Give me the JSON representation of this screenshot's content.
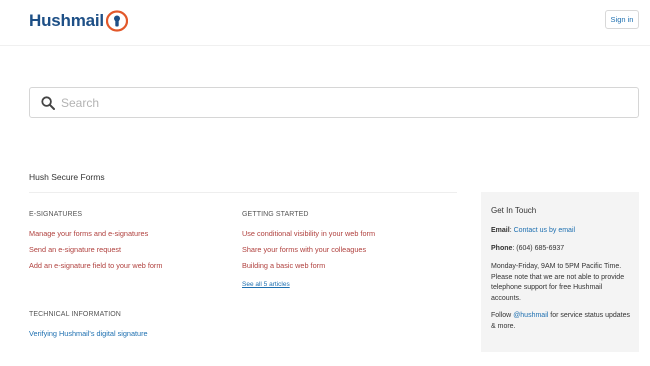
{
  "header": {
    "logo_text_a": "Hush",
    "logo_text_b": "mail",
    "signin_label": "Sign in"
  },
  "search": {
    "placeholder": "Search",
    "value": ""
  },
  "main": {
    "section_title": "Hush Secure Forms",
    "categories": [
      {
        "title": "E-SIGNATURES",
        "articles": [
          "Manage your forms and e-signatures",
          "Send an e-signature request",
          "Add an e-signature field to your web form"
        ]
      },
      {
        "title": "GETTING STARTED",
        "articles": [
          "Use conditional visibility in your web form",
          "Share your forms with your colleagues",
          "Building a basic web form"
        ],
        "see_all": "See all 5 articles"
      },
      {
        "title": "TECHNICAL INFORMATION",
        "articles": [
          "Verifying Hushmail's digital signature"
        ]
      }
    ]
  },
  "contact": {
    "title": "Get In Touch",
    "email_label": "Email",
    "email_link": "Contact us by email",
    "phone_label": "Phone",
    "phone_value": "(604) 685-6937",
    "hours_text": "Monday-Friday, 9AM to 5PM Pacific Time. Please note that we are not able to provide telephone support for free Hushmail accounts.",
    "follow_prefix": "Follow ",
    "follow_link": "@hushmail",
    "follow_suffix": " for service status updates & more."
  },
  "colors": {
    "brand": "#1d4f86",
    "accent_orange": "#e2582a",
    "article_link": "#b0413e",
    "link_blue": "#1d6fb0"
  }
}
